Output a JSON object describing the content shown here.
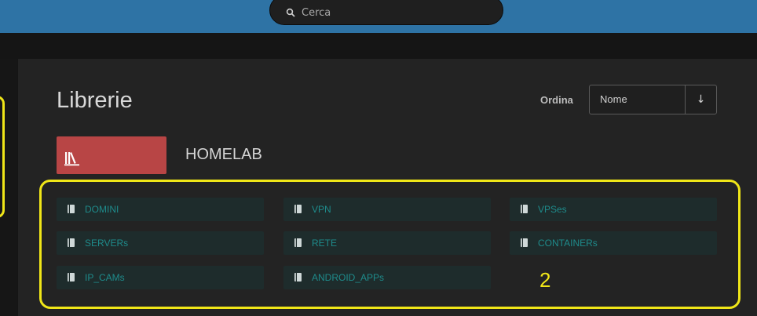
{
  "header": {
    "search": {
      "placeholder": "Cerca"
    }
  },
  "main": {
    "title": "Librerie",
    "sort": {
      "label": "Ordina",
      "value": "Nome",
      "direction_glyph": "↓"
    },
    "library": {
      "name": "HOMELAB"
    },
    "books": [
      {
        "label": "DOMINI"
      },
      {
        "label": "VPN"
      },
      {
        "label": "VPSes"
      },
      {
        "label": "SERVERs"
      },
      {
        "label": "RETE"
      },
      {
        "label": "CONTAINERs"
      },
      {
        "label": "IP_CAMs"
      },
      {
        "label": "ANDROID_APPs"
      }
    ],
    "annotation": "2"
  },
  "colors": {
    "topbar": "#2e73a5",
    "library_accent": "#b84545",
    "book_text": "#1e8b8b",
    "highlight": "#f0e618"
  }
}
